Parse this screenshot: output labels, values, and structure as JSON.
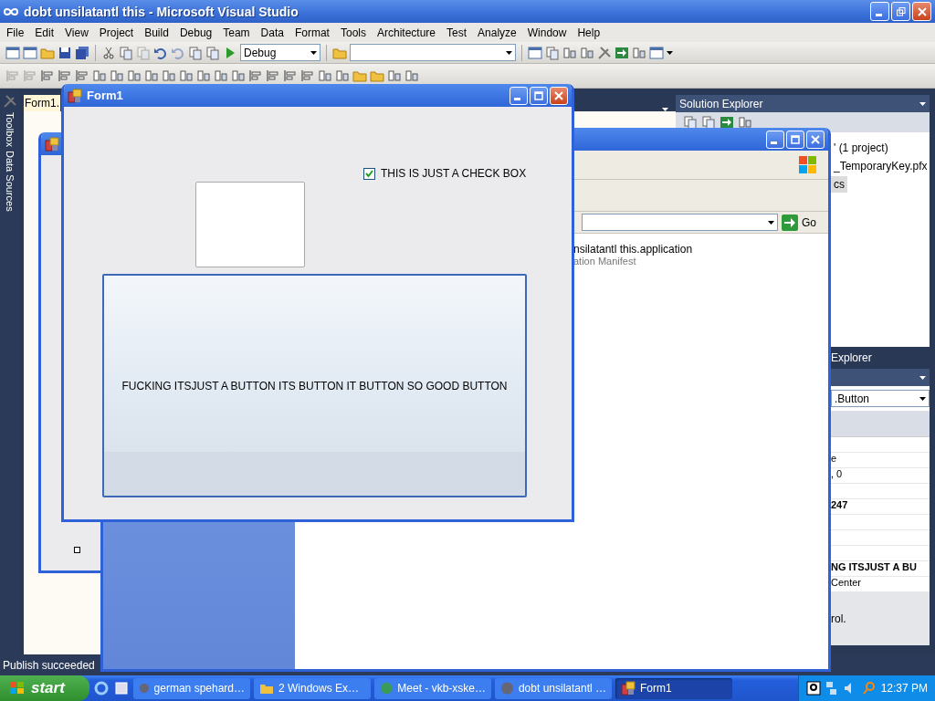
{
  "ide": {
    "title": "dobt unsilatantl this - Microsoft Visual Studio",
    "menu": [
      "File",
      "Edit",
      "View",
      "Project",
      "Build",
      "Debug",
      "Team",
      "Data",
      "Format",
      "Tools",
      "Architecture",
      "Test",
      "Analyze",
      "Window",
      "Help"
    ],
    "config_combo": {
      "value": "Debug"
    },
    "side_tabs": [
      "Toolbox",
      "Data Sources"
    ],
    "document_tab": {
      "label": "Form1."
    },
    "solution_explorer": {
      "title": "Solution Explorer",
      "items": [
        {
          "label": "' (1 project)",
          "selected": false
        },
        {
          "label": "_TemporaryKey.pfx",
          "selected": false
        },
        {
          "label": "cs",
          "selected": true
        }
      ]
    },
    "panel_tab": "Explorer",
    "properties": {
      "object": ".Button",
      "rows": [
        {},
        {
          "value": "e",
          "modified": false
        },
        {
          "value": ", 0",
          "modified": false
        },
        {},
        {
          "value": "247",
          "modified": true
        },
        {},
        {},
        {},
        {
          "value": "NG ITSJUST A BU",
          "modified": true
        },
        {
          "value": "Center",
          "modified": false
        }
      ],
      "description": "rol."
    },
    "status": "Publish succeeded"
  },
  "explorer_window": {
    "go_button": "Go",
    "files": [
      {
        "name": "nsilatantl this.application",
        "type": "ation Manifest"
      }
    ]
  },
  "form1": {
    "title": "Form1",
    "checkbox": {
      "label": "THIS IS JUST A CHECK BOX",
      "checked": true
    },
    "button": {
      "label": "FUCKING ITSJUST A BUTTON ITS BUTTON IT BUTTON SO GOOD BUTTON"
    }
  },
  "taskbar": {
    "start": "start",
    "tasks": [
      {
        "label": "german spehard…",
        "selected": false
      },
      {
        "label": "2 Windows Ex…",
        "selected": false
      },
      {
        "label": "Meet - vkb-xske…",
        "selected": false
      },
      {
        "label": "dobt unsilatantl …",
        "selected": false
      },
      {
        "label": "Form1",
        "selected": true
      }
    ],
    "clock": "12:37 PM"
  }
}
